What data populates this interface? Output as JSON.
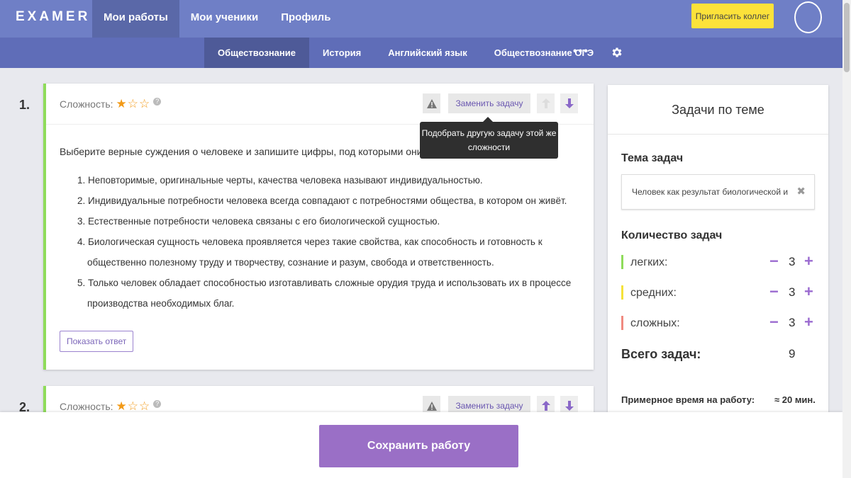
{
  "app": {
    "logo": "EXAMER"
  },
  "topnav": {
    "items": [
      {
        "label": "Мои работы",
        "active": true
      },
      {
        "label": "Мои ученики",
        "active": false
      },
      {
        "label": "Профиль",
        "active": false
      }
    ],
    "invite_label": "Пригласить коллег"
  },
  "subnav": {
    "items": [
      {
        "label": "Обществознание",
        "active": true
      },
      {
        "label": "История",
        "active": false
      },
      {
        "label": "Английский язык",
        "active": false
      },
      {
        "label": "Обществознание ОГЭ",
        "active": false
      }
    ],
    "more_label": "•••"
  },
  "tasks": [
    {
      "number": "1.",
      "difficulty_label": "Сложность:",
      "difficulty_stars": 1,
      "max_stars": 3,
      "replace_label": "Заменить задачу",
      "question": "Выберите верные суждения о человеке и запишите цифры, под которыми они указаны.",
      "options": [
        "1. Неповторимые, оригинальные черты, качества человека называют индивидуальностью.",
        "2. Индивидуальные потребности человека всегда совпадают с потребностями общества, в котором он живёт.",
        "3. Естественные потребности человека связаны с его биологической сущностью.",
        "4. Биологическая сущность человека проявляется через такие свойства, как способность и готовность к общественно полезному труду и творчеству, сознание и разум, свобода и ответственность.",
        "5. Только человек обладает способностью изготавливать сложные орудия труда и использовать их в процессе производства необходимых благ."
      ],
      "show_answer_label": "Показать ответ"
    },
    {
      "number": "2.",
      "difficulty_label": "Сложность:",
      "difficulty_stars": 1,
      "max_stars": 3,
      "replace_label": "Заменить задачу"
    }
  ],
  "tooltip": {
    "text": "Подобрать другую задачу этой же сложности"
  },
  "panel": {
    "title": "Задачи по теме",
    "topic_label": "Тема задач",
    "topic_value": "Человек как результат биологической и",
    "count_label": "Количество задач",
    "rows": [
      {
        "label": "легких:",
        "count": "3",
        "color": "#8fdc5a"
      },
      {
        "label": "средних:",
        "count": "3",
        "color": "#f5e23a"
      },
      {
        "label": "сложных:",
        "count": "3",
        "color": "#f08a80"
      }
    ],
    "total_label": "Всего задач:",
    "total_value": "9",
    "time_label": "Примерное время на работу:",
    "time_value": "≈ 20 мин."
  },
  "save_label": "Сохранить работу",
  "colors": {
    "accent": "#9a6fc6",
    "nav": "#6f7fc6",
    "invite": "#fce23a"
  },
  "icons": [
    "warning-icon",
    "arrow-up-icon",
    "arrow-down-icon",
    "gear-icon",
    "star-icon",
    "help-icon",
    "close-icon",
    "minus-icon",
    "plus-icon"
  ]
}
